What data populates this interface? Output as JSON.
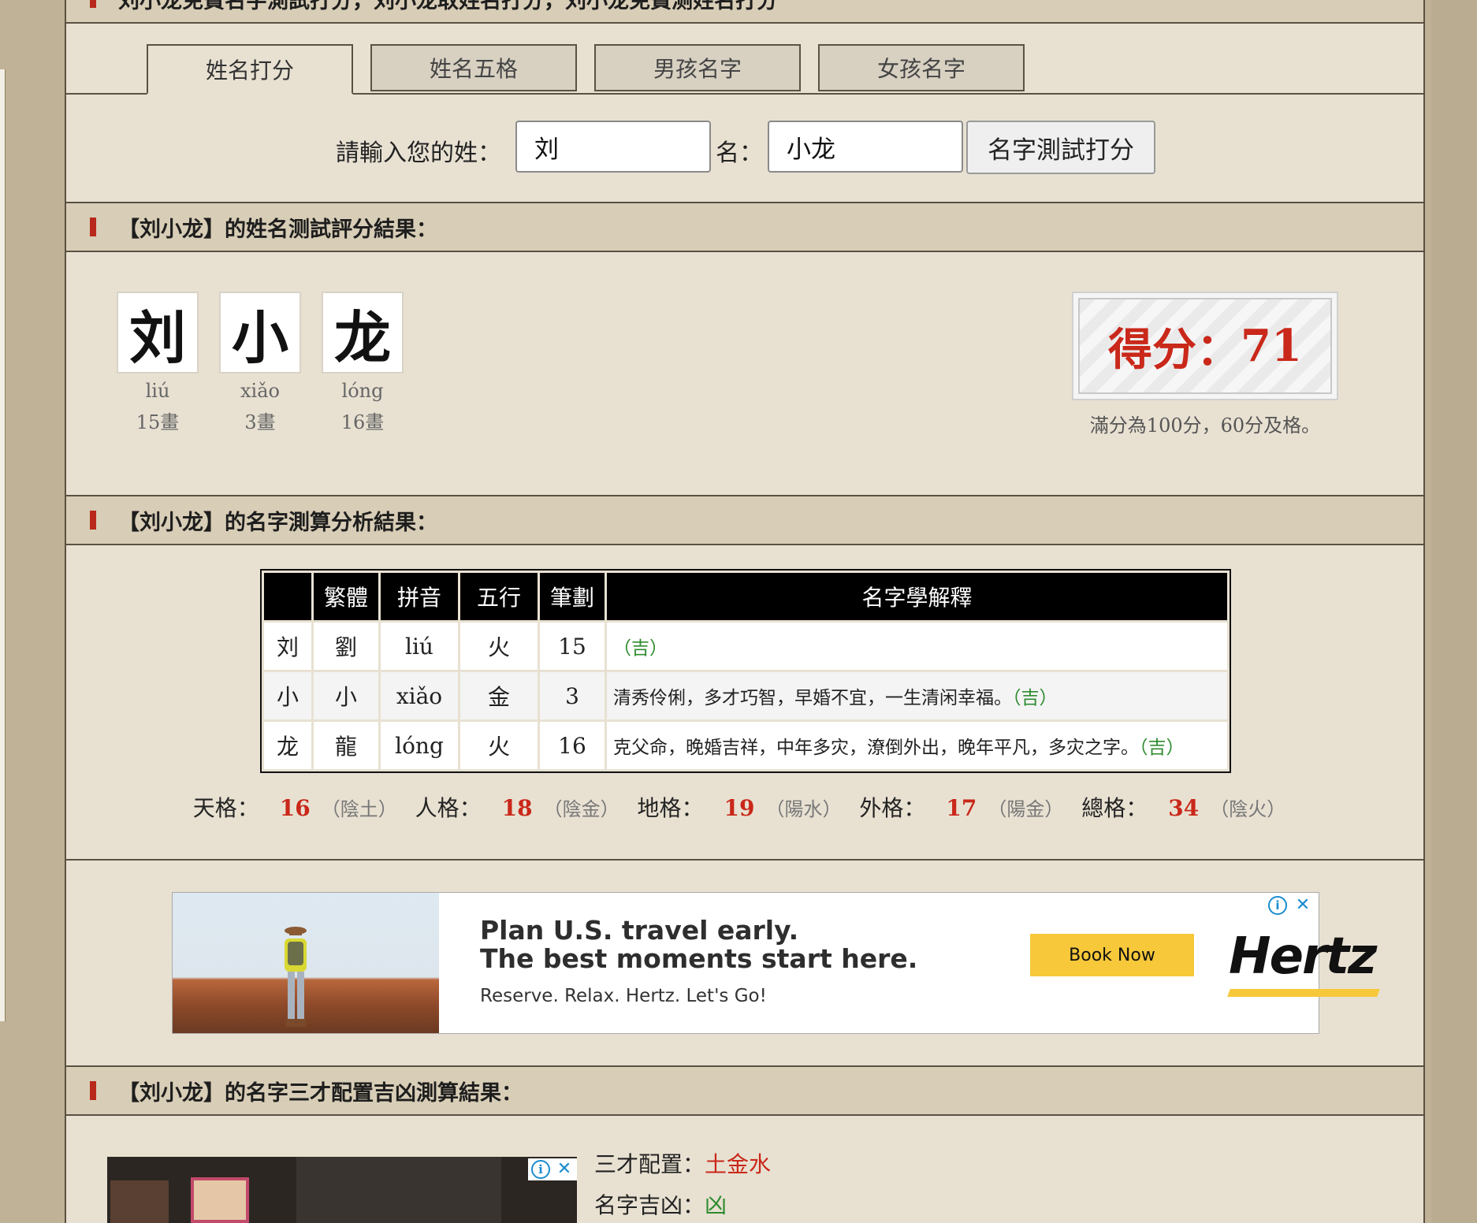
{
  "top_bar_text": "刘小龙免費名字測試打分，刘小龙取姓名打分，刘小龙免費测姓名打分",
  "tabs": [
    {
      "label": "姓名打分",
      "active": true
    },
    {
      "label": "姓名五格",
      "active": false
    },
    {
      "label": "男孩名字",
      "active": false
    },
    {
      "label": "女孩名字",
      "active": false
    }
  ],
  "form": {
    "surname_label": "請輸入您的姓：",
    "surname_value": "刘",
    "given_label": "名：",
    "given_value": "小龙",
    "submit_label": "名字測試打分"
  },
  "section1": {
    "title": "【刘小龙】的姓名测試評分結果："
  },
  "chars": [
    {
      "char": "刘",
      "pinyin": "liú",
      "strokes": "15畫"
    },
    {
      "char": "小",
      "pinyin": "xiǎo",
      "strokes": "3畫"
    },
    {
      "char": "龙",
      "pinyin": "lóng",
      "strokes": "16畫"
    }
  ],
  "score": {
    "label": "得分：",
    "value": "71",
    "note": "滿分為100分，60分及格。"
  },
  "section2": {
    "title": "【刘小龙】的名字測算分析結果："
  },
  "table": {
    "headers": [
      "",
      "繁體",
      "拼音",
      "五行",
      "筆劃",
      "名字學解釋"
    ],
    "rows": [
      {
        "char": "刘",
        "trad": "劉",
        "pinyin": "liú",
        "wuxing": "火",
        "strokes": "15",
        "explain": "",
        "luck": "（吉）"
      },
      {
        "char": "小",
        "trad": "小",
        "pinyin": "xiǎo",
        "wuxing": "金",
        "strokes": "3",
        "explain": "清秀伶俐，多才巧智，早婚不宜，一生清闲幸福。",
        "luck": "（吉）"
      },
      {
        "char": "龙",
        "trad": "龍",
        "pinyin": "lóng",
        "wuxing": "火",
        "strokes": "16",
        "explain": "克父命，晚婚吉祥，中年多灾，潦倒外出，晚年平凡，多灾之字。",
        "luck": "（吉）"
      }
    ]
  },
  "grids": [
    {
      "label": "天格：",
      "num": "16",
      "sub": "（陰土）"
    },
    {
      "label": "人格：",
      "num": "18",
      "sub": "（陰金）"
    },
    {
      "label": "地格：",
      "num": "19",
      "sub": "（陽水）"
    },
    {
      "label": "外格：",
      "num": "17",
      "sub": "（陽金）"
    },
    {
      "label": "總格：",
      "num": "34",
      "sub": "（陰火）"
    }
  ],
  "ad": {
    "headline1": "Plan U.S. travel early.",
    "headline2": "The best moments start here.",
    "subline": "Reserve. Relax. Hertz. Let's Go!",
    "cta": "Book Now",
    "brand": "Hertz"
  },
  "section3": {
    "title": "【刘小龙】的名字三才配置吉凶測算結果："
  },
  "bottom": {
    "sancai_label": "三才配置：",
    "sancai_value": "土金水",
    "luck_label": "名字吉凶：",
    "luck_value": "凶"
  },
  "colors": {
    "accent_red": "#c9281a",
    "good_green": "#2e8b2e",
    "bar_bg": "#d8cdb6",
    "panel_bg": "#e8e1d2"
  }
}
